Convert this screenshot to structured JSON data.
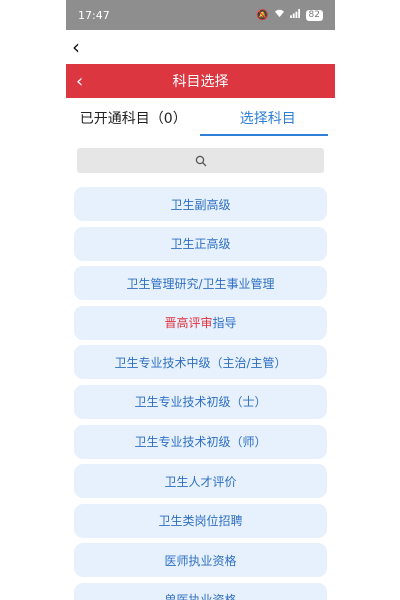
{
  "status": {
    "time": "17:47",
    "battery": "82",
    "icons": [
      "mute-icon",
      "wifi-icon",
      "signal-icon",
      "battery-icon"
    ]
  },
  "nav": {
    "title": "科目选择"
  },
  "tabs": [
    {
      "label": "已开通科目（0）"
    },
    {
      "label": "选择科目"
    }
  ],
  "search": {
    "icon": "search-icon"
  },
  "list": {
    "items": [
      {
        "label": "卫生副高级"
      },
      {
        "label": "卫生正高级"
      },
      {
        "label": "卫生管理研究/卫生事业管理"
      },
      {
        "highlight": "晋高评审",
        "label": "指导"
      },
      {
        "label": "卫生专业技术中级（主治/主管）"
      },
      {
        "label": "卫生专业技术初级（士）"
      },
      {
        "label": "卫生专业技术初级（师）"
      },
      {
        "label": "卫生人才评价"
      },
      {
        "label": "卫生类岗位招聘"
      },
      {
        "label": "医师执业资格"
      },
      {
        "label": "兽医执业资格"
      }
    ]
  },
  "colors": {
    "accent": "#dc3640",
    "tab_active": "#2f7fd8",
    "item_bg": "#e7f1fd",
    "item_text": "#2f6fc2"
  }
}
